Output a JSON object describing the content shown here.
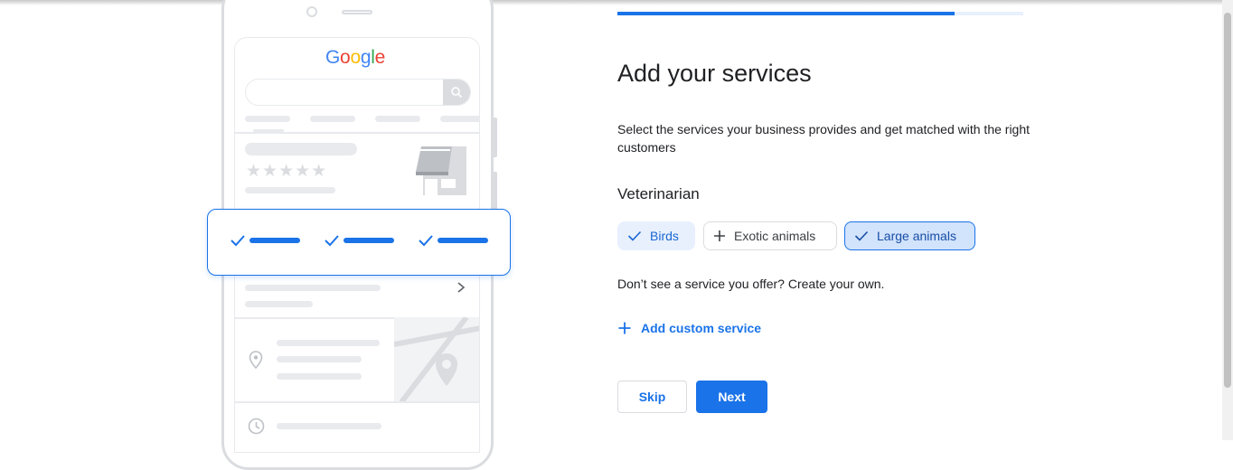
{
  "illustration": {
    "logo_text": [
      "G",
      "o",
      "o",
      "g",
      "l",
      "e"
    ],
    "logo_colors": [
      "#4285f4",
      "#ea4335",
      "#fbbc05",
      "#4285f4",
      "#34a853",
      "#ea4335"
    ],
    "stars": "★★★★★"
  },
  "progress": {
    "fraction": 0.83,
    "color": "#1a73e8"
  },
  "page": {
    "title": "Add your services",
    "description": "Select the services your business provides and get matched with the right customers",
    "category": "Veterinarian"
  },
  "chips": [
    {
      "label": "Birds",
      "selected": true,
      "icon": "check-icon"
    },
    {
      "label": "Exotic animals",
      "selected": false,
      "icon": "plus-icon"
    },
    {
      "label": "Large animals",
      "selected": true,
      "icon": "check-icon"
    }
  ],
  "custom": {
    "note": "Don’t see a service you offer? Create your own.",
    "add_label": "Add custom service"
  },
  "actions": {
    "skip_label": "Skip",
    "next_label": "Next"
  },
  "colors": {
    "accent": "#1a73e8",
    "chip_selected_bg": "#e8f0fe"
  }
}
